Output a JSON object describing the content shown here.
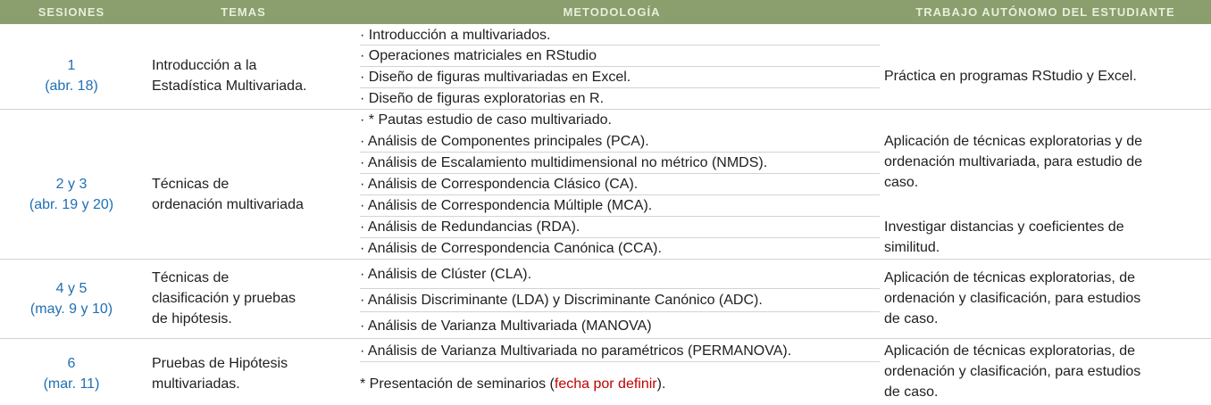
{
  "header": {
    "col1": "SESIONES",
    "col2": "TEMAS",
    "col3": "METODOLOGÍA",
    "col4": "TRABAJO AUTÓNOMO DEL ESTUDIANTE"
  },
  "sessions": [
    {
      "num": "1",
      "date": "(abr. 18)",
      "tema1": "Introducción a la",
      "tema2": "Estadística Multivariada."
    },
    {
      "num": "2 y 3",
      "date": "(abr. 19 y 20)",
      "tema1": "Técnicas de",
      "tema2": "ordenación multivariada"
    },
    {
      "num": "4 y 5",
      "date": "(may. 9 y 10)",
      "tema1": "Técnicas de",
      "tema2": "clasificación y pruebas",
      "tema3": "de hipótesis."
    },
    {
      "num": "6",
      "date": "(mar. 11)",
      "tema1": "Pruebas de Hipótesis",
      "tema2": "multivariadas."
    }
  ],
  "metodologia": [
    "· Introducción a multivariados.",
    "· Operaciones matriciales en RStudio",
    "· Diseño de figuras multivariadas en Excel.",
    "· Diseño de figuras exploratorias en R.",
    "· * Pautas estudio de caso multivariado.",
    "· Análisis de Componentes principales (PCA).",
    "· Análisis de Escalamiento multidimensional no métrico (NMDS).",
    "· Análisis de Correspondencia Clásico (CA).",
    "· Análisis de Correspondencia Múltiple (MCA).",
    "· Análisis de Redundancias (RDA).",
    "· Análisis de Correspondencia Canónica (CCA).",
    "· Análisis de Clúster (CLA).",
    "· Análisis Discriminante (LDA) y Discriminante Canónico (ADC).",
    "· Análisis de Varianza Multivariada (MANOVA)",
    "· Análisis de Varianza Multivariada no paramétricos (PERMANOVA)."
  ],
  "final_pre": "* Presentación de seminarios (",
  "final_red": "fecha por definir",
  "final_post": ").",
  "trabajo": {
    "t1": "Práctica en programas RStudio y Excel.",
    "t2a": "Aplicación de técnicas exploratorias y de",
    "t2b": "ordenación multivariada, para estudio de",
    "t2c": "caso.",
    "t3a": "Investigar distancias y coeficientes de",
    "t3b": "similitud.",
    "t4a": "Aplicación de técnicas exploratorias, de",
    "t4b": "ordenación y clasificación, para estudios",
    "t4c": "de caso.",
    "t5a": "Aplicación de técnicas exploratorias, de",
    "t5b": "ordenación y clasificación, para estudios",
    "t5c": "de caso."
  },
  "colors": {
    "header_bg": "#8a9e6e",
    "session_blue": "#1f6fb3",
    "highlight_red": "#c00000"
  }
}
